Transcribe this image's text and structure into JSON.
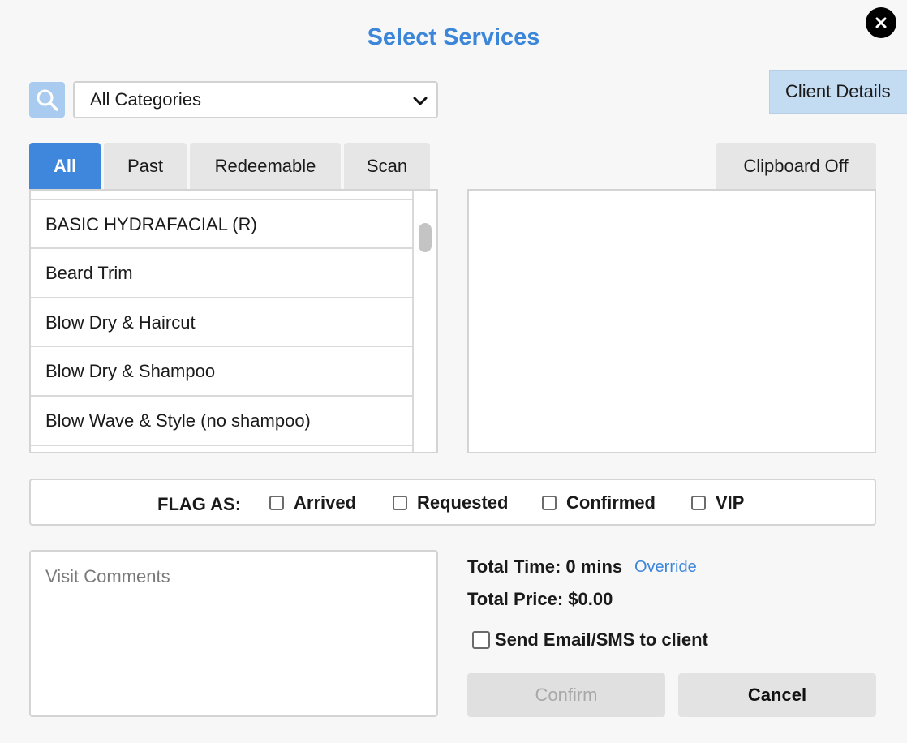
{
  "dialog": {
    "title": "Select Services",
    "close_icon": "close-icon"
  },
  "filter": {
    "search_icon": "search-icon",
    "category_selected": "All Categories",
    "client_details_label": "Client Details"
  },
  "tabs": [
    {
      "label": "All",
      "active": true
    },
    {
      "label": "Past",
      "active": false
    },
    {
      "label": "Redeemable",
      "active": false
    },
    {
      "label": "Scan",
      "active": false
    }
  ],
  "clipboard_label": "Clipboard Off",
  "services": [
    "BASIC HYDRAFACIAL (R)",
    "Beard Trim",
    "Blow Dry & Haircut",
    "Blow Dry & Shampoo",
    "Blow Wave & Style (no shampoo)"
  ],
  "flags": {
    "label": "FLAG AS:",
    "options": [
      "Arrived",
      "Requested",
      "Confirmed",
      "VIP"
    ]
  },
  "comments": {
    "placeholder": "Visit Comments"
  },
  "totals": {
    "time": "Total Time: 0 mins",
    "override_label": "Override",
    "price": "Total Price: $0.00"
  },
  "notify": {
    "label": "Send Email/SMS to client"
  },
  "actions": {
    "confirm_label": "Confirm",
    "cancel_label": "Cancel"
  },
  "colors": {
    "accent": "#3b86d9",
    "tab_active": "#3f87dc",
    "client_details_bg": "#c4dcf1"
  }
}
